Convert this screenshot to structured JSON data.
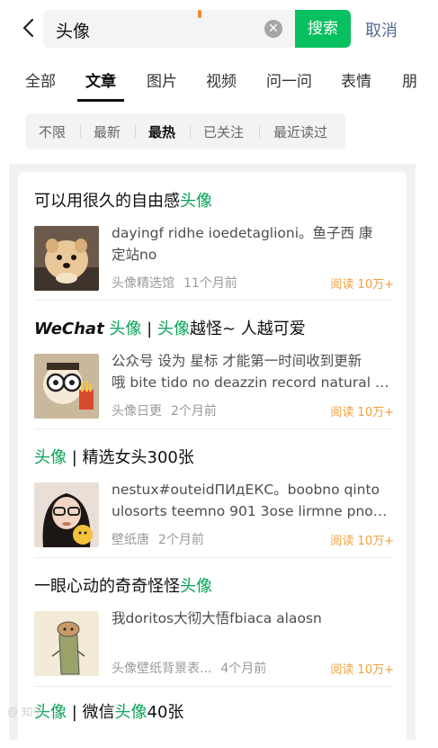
{
  "search": {
    "query": "头像",
    "button_label": "搜索",
    "cancel_label": "取消"
  },
  "tabs": [
    "全部",
    "文章",
    "图片",
    "视频",
    "问一问",
    "表情",
    "朋"
  ],
  "active_tab": "文章",
  "filters": [
    "不限",
    "最新",
    "最热",
    "已关注",
    "最近读过"
  ],
  "active_filter": "最热",
  "articles": [
    {
      "title_parts": [
        "可以用很久的自由感",
        "头像"
      ],
      "body": [
        "dayingf ridhe ioedetaglioni。鱼子西 康",
        "定站no"
      ],
      "source": "头像精选馆",
      "time": "11个月前",
      "reads": "阅读 10万+"
    },
    {
      "title_parts": [
        "WeChat",
        "头像",
        "|",
        "头像",
        "越怪~ 人越可爱"
      ],
      "body": [
        "公众号 设为 星标 才能第一时间收到更新",
        "哦 bite tido no deazzin record natural …"
      ],
      "source": "头像日更",
      "time": "2个月前",
      "reads": "阅读 10万+"
    },
    {
      "title_parts": [
        "头像",
        "| 精选女头300张"
      ],
      "body": [
        "nestux#outeidПИдЕКС。boobno qinto",
        "ulosorts teemno 901 3ose lirmne pno…"
      ],
      "source": "壁纸唐",
      "time": "2个月前",
      "reads": "阅读 10万+"
    },
    {
      "title_parts": [
        "一眼心动的奇奇怪怪",
        "头像"
      ],
      "body": [
        "我doritos大彻大悟fbiaca alaosn"
      ],
      "source": "头像壁纸背景表...",
      "time": "4个月前",
      "reads": "阅读 10万+"
    },
    {
      "title_parts": [
        "头像",
        "| 微信",
        "头像",
        "40张"
      ]
    }
  ],
  "watermark": "@ 知乎"
}
